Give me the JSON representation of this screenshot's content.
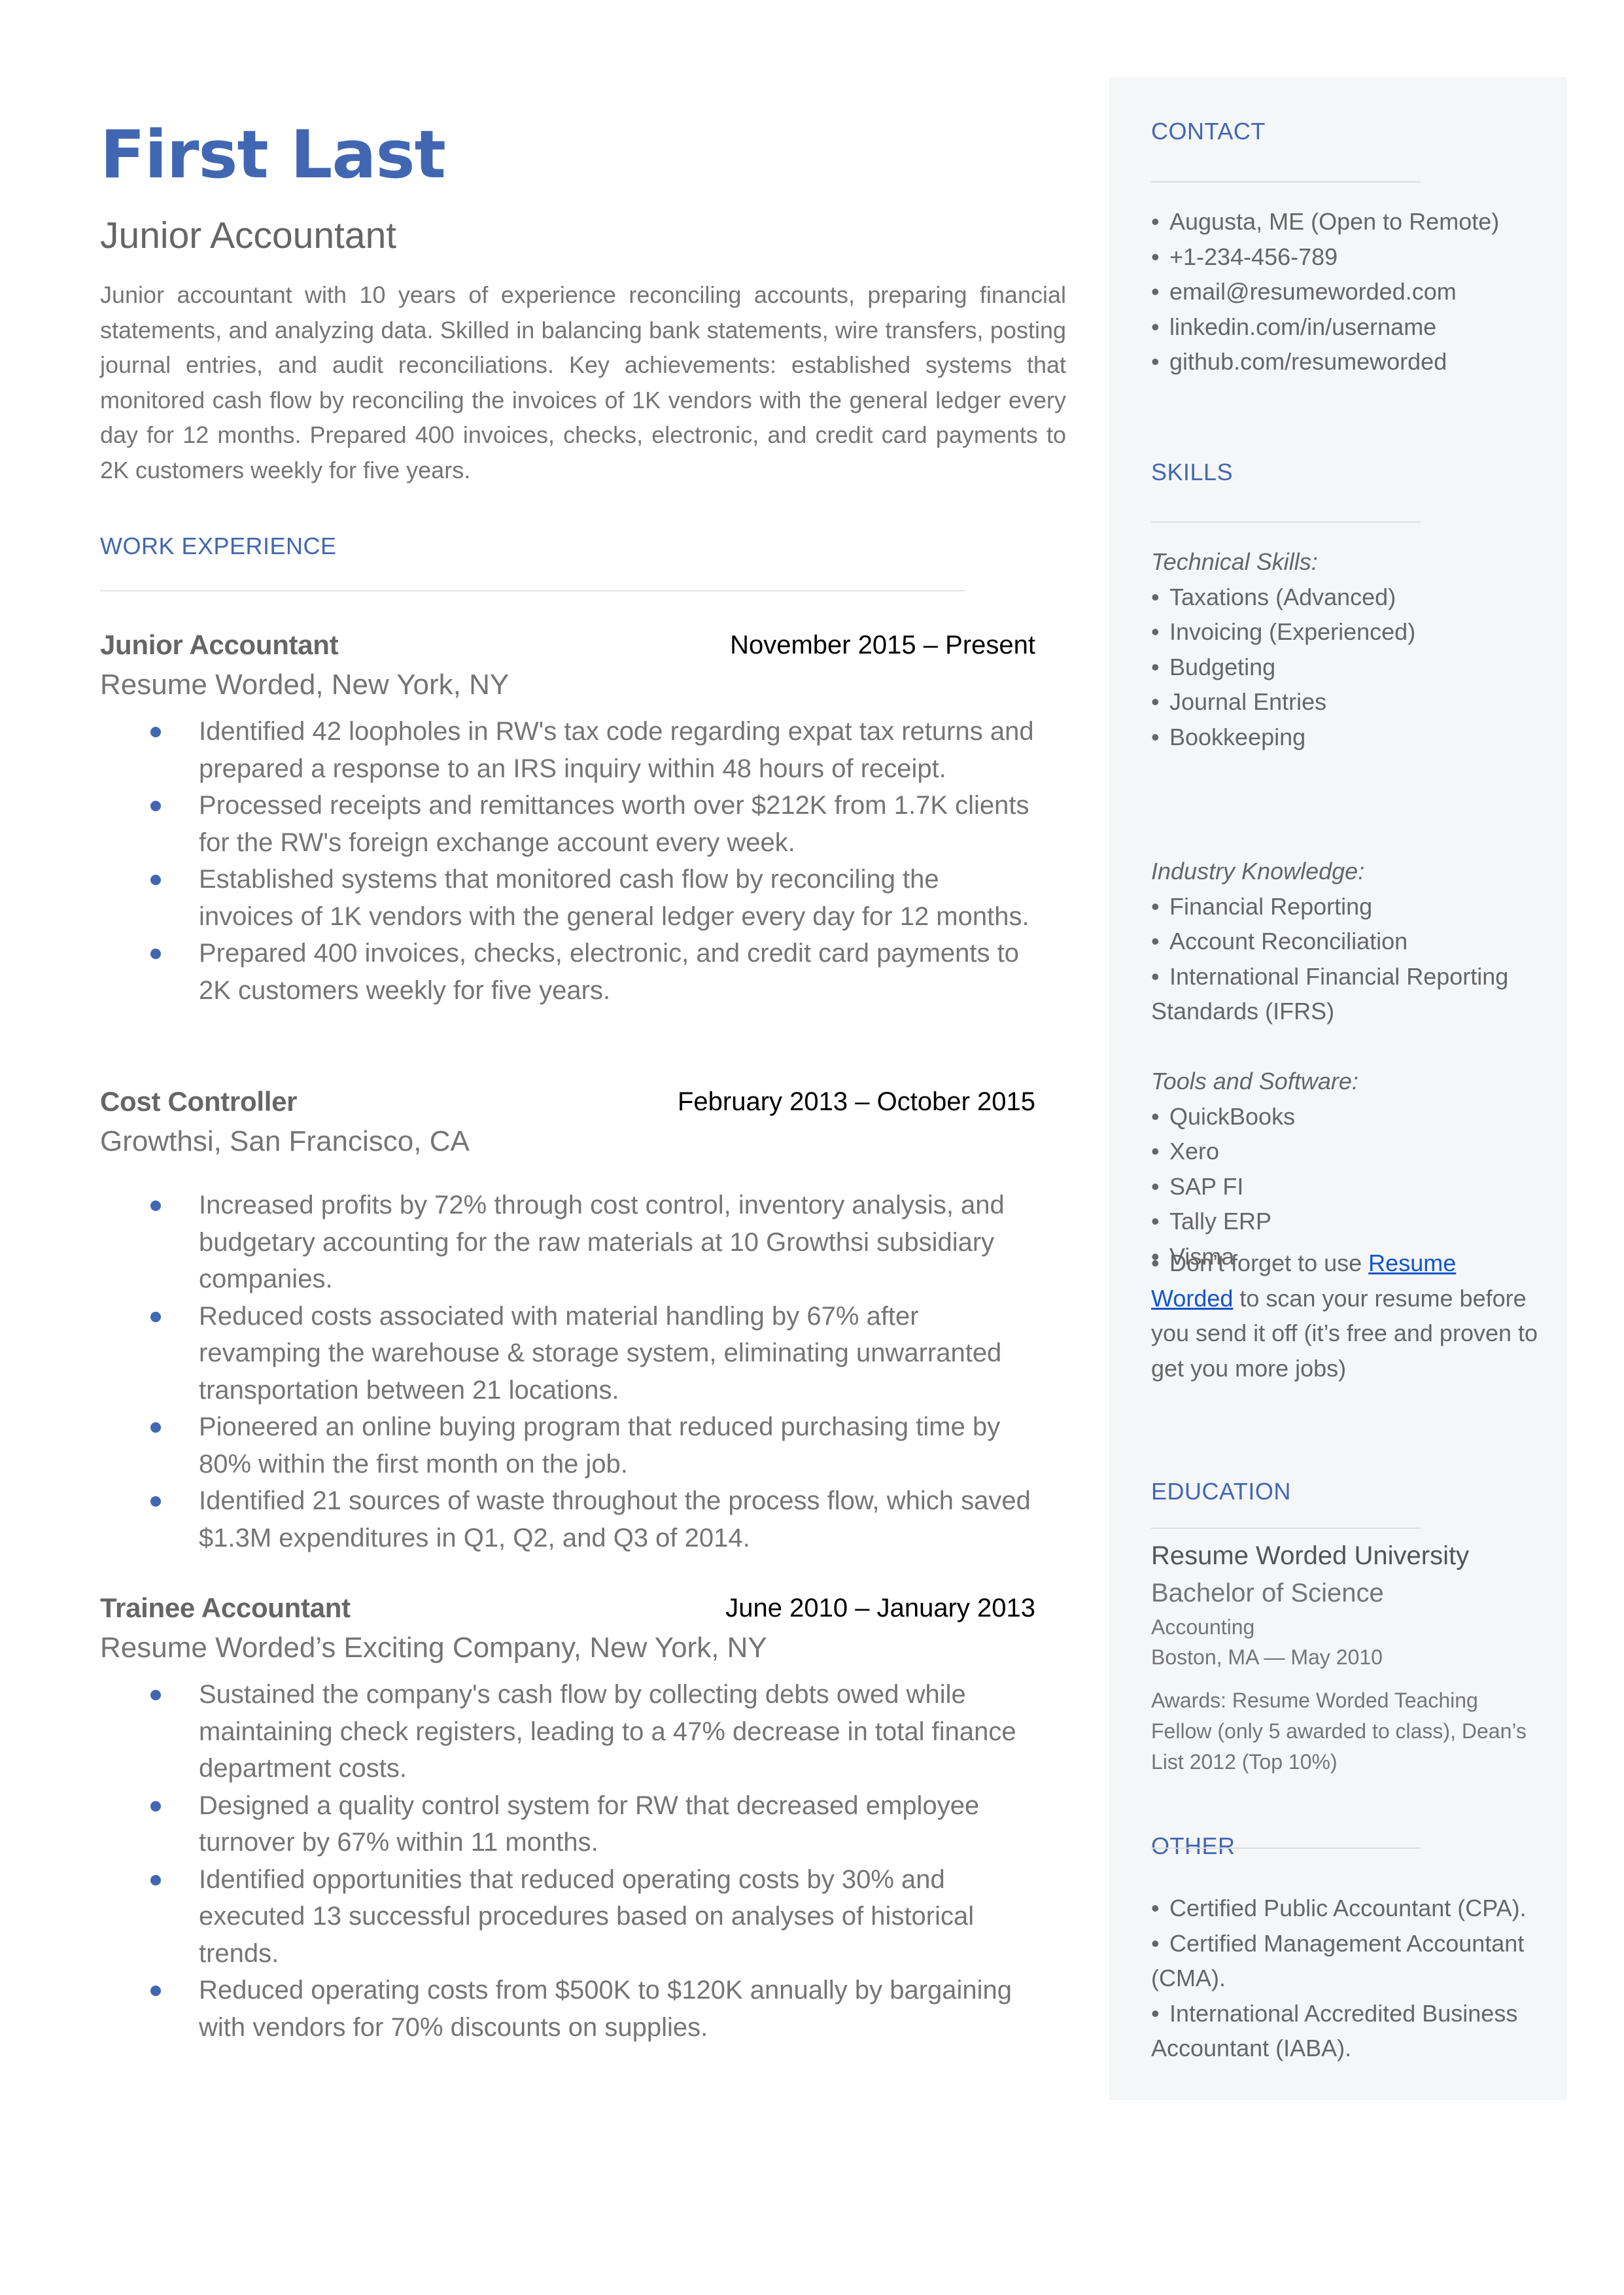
{
  "header": {
    "name": "First Last",
    "headline": "Junior Accountant",
    "summary": "Junior accountant with 10 years of experience reconciling accounts, preparing financial statements, and analyzing data. Skilled in balancing bank statements, wire transfers, posting journal entries, and audit reconciliations. Key achievements: established systems that monitored cash flow by reconciling the invoices of 1K vendors with the general ledger every day for 12 months. Prepared 400 invoices, checks, electronic, and credit card payments to 2K customers weekly for five years."
  },
  "work": {
    "title": "WORK EXPERIENCE",
    "jobs": [
      {
        "title": "Junior Accountant",
        "dates": "November 2015 – Present",
        "company": "Resume Worded, New York, NY",
        "bullets": [
          "Identified 42 loopholes in RW's tax code regarding expat tax returns and prepared a response to an IRS inquiry within 48 hours of receipt.",
          "Processed receipts and remittances worth over $212K from 1.7K clients for the RW's foreign exchange account every week.",
          "Established systems that monitored cash flow by reconciling the invoices of 1K vendors with the general ledger every day for 12 months.",
          "Prepared 400 invoices, checks, electronic, and credit card payments to 2K customers weekly for five years."
        ]
      },
      {
        "title": "Cost Controller",
        "dates": "February 2013 – October 2015",
        "company": "Growthsi, San Francisco, CA",
        "bullets": [
          "Increased profits by 72% through cost control, inventory analysis, and budgetary accounting for the raw materials at 10 Growthsi subsidiary companies.",
          "Reduced costs associated with material handling by 67% after revamping the warehouse & storage system, eliminating unwarranted transportation between 21 locations.",
          "Pioneered an online buying program that reduced purchasing time by 80% within the first month on the job.",
          "Identified 21 sources of waste throughout the process flow, which saved $1.3M expenditures in Q1, Q2, and Q3 of 2014."
        ]
      },
      {
        "title": "Trainee Accountant",
        "dates": "June 2010 – January 2013",
        "company": "Resume Worded’s Exciting Company, New York, NY",
        "bullets": [
          "Sustained the company's cash flow by collecting debts owed while maintaining check registers, leading to a 47% decrease in total finance department costs.",
          "Designed a quality control system for RW that decreased employee turnover by 67% within 11 months.",
          "Identified opportunities that reduced operating costs by 30% and executed 13 successful procedures based on analyses of historical trends.",
          "Reduced operating costs from $500K to $120K annually by bargaining with vendors for 70% discounts on supplies."
        ]
      }
    ]
  },
  "sidebar": {
    "contact": {
      "title": "CONTACT",
      "items": [
        "Augusta, ME (Open to Remote)",
        "+1-234-456-789",
        "email@resumeworded.com",
        "linkedin.com/in/username",
        "github.com/resumeworded"
      ]
    },
    "skills": {
      "title": "SKILLS",
      "technical_label": "Technical Skills:",
      "technical": [
        "Taxations (Advanced)",
        "Invoicing (Experienced)",
        "Budgeting",
        "Journal Entries",
        "Bookkeeping"
      ],
      "industry_label": "Industry Knowledge:",
      "industry": [
        "Financial Reporting",
        "Account Reconciliation",
        "International Financial Reporting Standards (IFRS)"
      ],
      "tools_label": "Tools and Software:",
      "tools": [
        "QuickBooks",
        "Xero",
        "SAP FI",
        "Tally ERP",
        "Visma"
      ],
      "tip_prefix": "Don’t forget to use ",
      "tip_link": "Resume Worded",
      "tip_suffix": " to scan your resume before you send it off (it’s free and proven to get you more jobs)"
    },
    "education": {
      "title": "EDUCATION",
      "school": "Resume Worded University",
      "degree": "Bachelor of Science",
      "field": "Accounting",
      "location_date": "Boston, MA — May 2010",
      "awards": "Awards: Resume Worded Teaching Fellow (only 5 awarded to class), Dean’s List 2012 (Top 10%)"
    },
    "other": {
      "title": "OTHER",
      "items": [
        "Certified Public Accountant (CPA).",
        "Certified Management Accountant (CMA).",
        "International Accredited Business Accountant (IABA)."
      ]
    }
  },
  "colors": {
    "accent": "#4267b2",
    "link": "#1155cc",
    "sidebar_bg": "#f5f6f8"
  }
}
